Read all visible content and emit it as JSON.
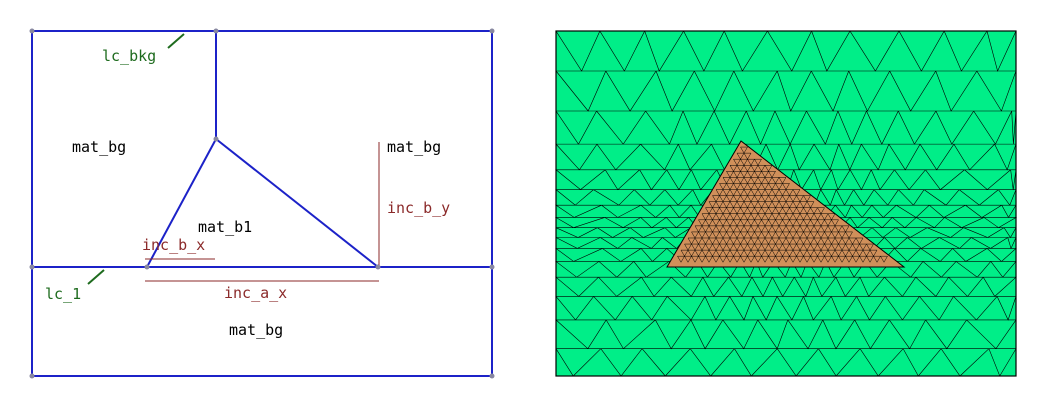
{
  "geometry": {
    "labels": {
      "lc_bkg": "lc_bkg",
      "lc_1": "lc_1",
      "mat_bg_top_left": "mat_bg",
      "mat_bg_top_right": "mat_bg",
      "mat_bg_bottom": "mat_bg",
      "mat_b1": "mat_b1",
      "inc_b_x": "inc_b_x",
      "inc_b_y": "inc_b_y",
      "inc_a_x": "inc_a_x"
    }
  },
  "colors": {
    "boundary": "#1c22c8",
    "vertex": "#8888a0",
    "label_green": "#1e6b1e",
    "label_red": "#8b2a2a",
    "mesh_background": "#00ee88",
    "mesh_inclusion": "#d0905a",
    "mesh_edge": "#000000"
  }
}
